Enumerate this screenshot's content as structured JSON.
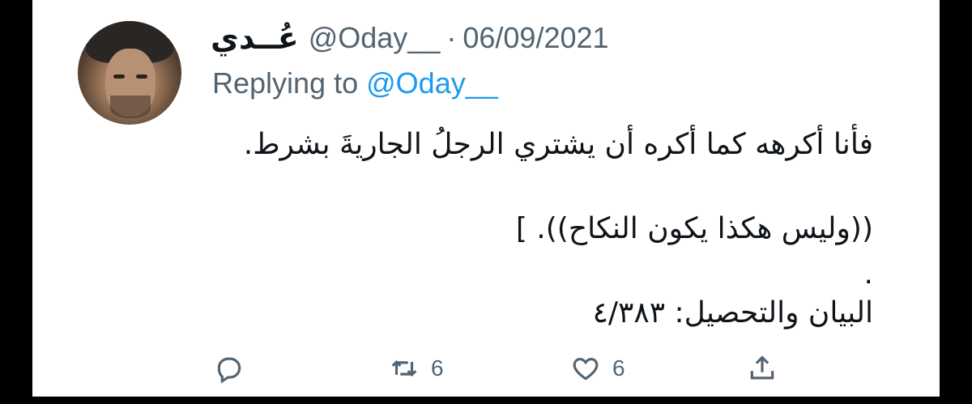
{
  "tweet": {
    "display_name": "عُــدي",
    "handle": "@Oday__",
    "separator": "·",
    "date": "06/09/2021",
    "replying_prefix": "Replying to",
    "replying_to": "@Oday__",
    "lines": [
      "فأنا أكرهه كما أكره أن يشتري الرجلُ الجاريةَ بشرط.",
      "((وليس هكذا يكون النكاح)). ]",
      ".",
      "البيان والتحصيل: ٤/٣٨٣"
    ]
  },
  "actions": {
    "reply": {
      "icon": "reply-icon",
      "count": ""
    },
    "retweet": {
      "icon": "retweet-icon",
      "count": "6"
    },
    "like": {
      "icon": "heart-icon",
      "count": "6"
    },
    "share": {
      "icon": "share-icon",
      "count": ""
    }
  },
  "colors": {
    "text": "#0f1419",
    "secondary": "#536471",
    "link": "#1d9bf0",
    "background": "#ffffff",
    "frame": "#000000"
  }
}
